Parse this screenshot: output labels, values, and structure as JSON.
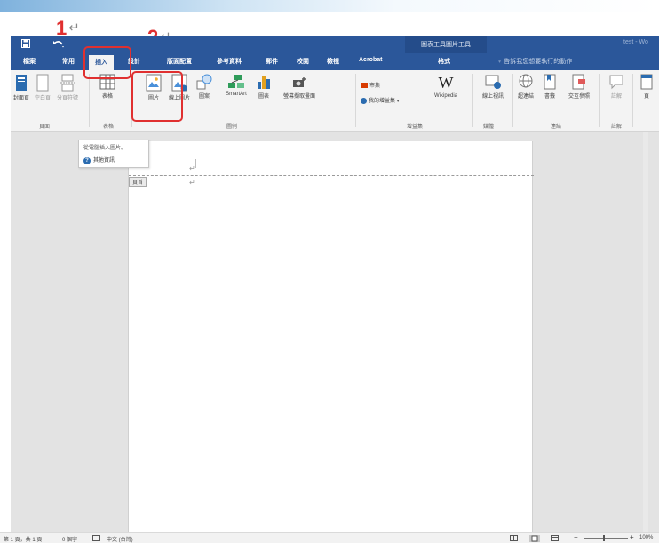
{
  "annotations": {
    "step1": "1",
    "step2": "2",
    "return_mark": "↵"
  },
  "titlebar": {
    "save_icon": "save-icon",
    "undo_icon": "undo-icon",
    "tool_title": "圖表工具圖片工具",
    "doc_title": "test - Wo"
  },
  "tabs": {
    "file": "檔案",
    "home": "常用",
    "insert": "插入",
    "design": "設計",
    "layout": "版面配置",
    "references": "參考資料",
    "mailings": "郵件",
    "review": "校閱",
    "view": "檢視",
    "acrobat": "Acrobat",
    "format": "格式",
    "search": "♀ 告訴我您想要執行的動作"
  },
  "ribbon": {
    "cover_page": "封面頁",
    "blank_page": "空白頁",
    "page_break": "分頁符號",
    "pages_group": "頁面",
    "table": "表格",
    "tables_group": "表格",
    "pictures": "圖片",
    "online_pictures": "線上圖片",
    "shapes": "圖案",
    "smartart": "SmartArt",
    "chart": "圖表",
    "screenshot": "螢幕擷取畫面",
    "illustrations_group": "圖例",
    "store": "市集",
    "my_addins": "我的增益集",
    "wikipedia": "Wikipedia",
    "addins_group": "增益集",
    "online_video": "線上視訊",
    "media_group": "媒體",
    "link": "超連結",
    "bookmark": "書籤",
    "cross_reference": "交互參照",
    "links_group": "連結",
    "comment": "註解",
    "comments_group": "註解",
    "header_partial": "頁"
  },
  "document": {
    "header_tag": "頁首",
    "para_mark": "↵"
  },
  "popup": {
    "tooltip": "從電腦插入圖片。",
    "more_info": "其他資訊"
  },
  "statusbar": {
    "page": "第 1 頁，共 1 頁",
    "words": "0 個字",
    "language": "中文 (台灣)",
    "zoom": "100%"
  },
  "colors": {
    "ribbon_blue": "#2b579a",
    "annotation_red": "#e03030"
  }
}
